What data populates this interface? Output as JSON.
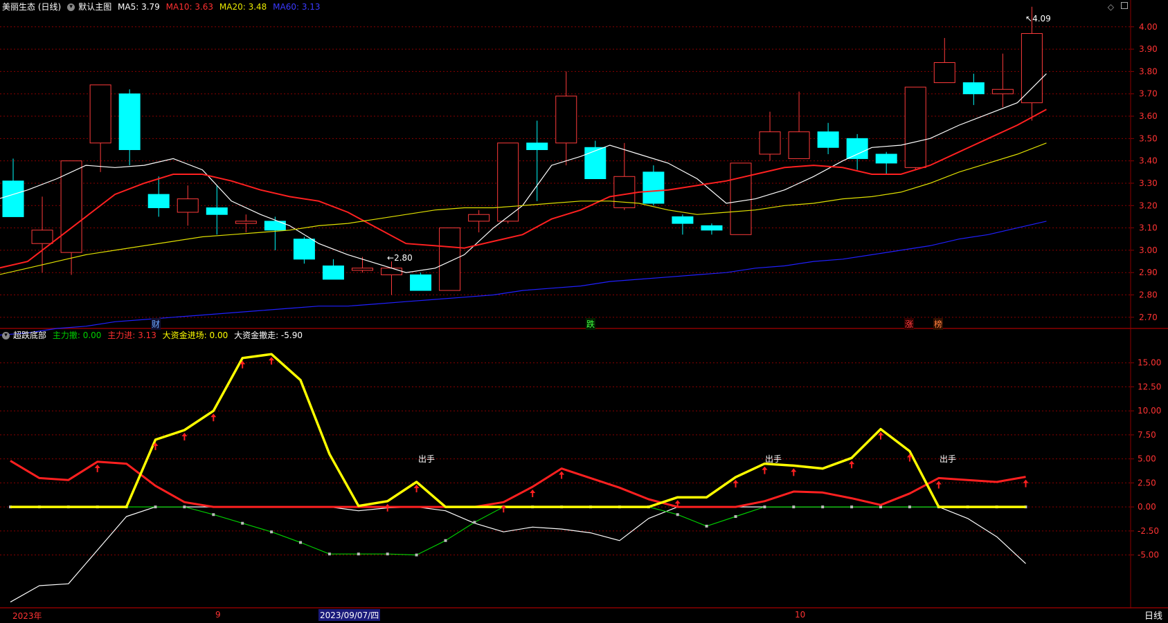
{
  "main_header": {
    "stock_title": "美丽生态 (日线)",
    "chart_name": "默认主图",
    "ma5": "MA5: 3.79",
    "ma10": "MA10: 3.63",
    "ma20": "MA20: 3.48",
    "ma60": "MA60: 3.13"
  },
  "sub_header": {
    "indicator_name": "超跌底部",
    "zhuli_che": "主力撤: 0.00",
    "zhuli_jin": "主力进: 3.13",
    "dazijin_jinchang": "大资金进场: 0.00",
    "dazijin_chezou": "大资金撤走: -5.90"
  },
  "annotations": {
    "high_label": "4.09",
    "low_label": "2.80",
    "chushou": "出手",
    "event_cai": "财",
    "event_die": "跌",
    "event_zhang": "涨",
    "event_bang": "榜"
  },
  "x_axis": {
    "year_label": "2023年",
    "month_9": "9",
    "month_10": "10",
    "selected_date": "2023/09/07/四"
  },
  "period_tab": "日线",
  "colors": {
    "up": "#ff3b3b",
    "down": "#00ffff",
    "ma5": "#ffffff",
    "ma10": "#ff2020",
    "ma20": "#e0e000",
    "ma60": "#2020ff",
    "grid": "#8b0000",
    "axis_text": "#ff3333"
  },
  "chart_data": [
    {
      "type": "candlestick",
      "title": "美丽生态 (日线)",
      "ylim": [
        2.65,
        4.12
      ],
      "yticks": [
        "2.80",
        "2.70",
        "2.80",
        "2.90",
        "3.00",
        "3.10",
        "3.20",
        "3.30",
        "3.40",
        "3.50",
        "3.60",
        "3.70",
        "3.80",
        "3.90",
        "4.00"
      ],
      "ytick_values": [
        2.6,
        2.7,
        2.8,
        2.9,
        3.0,
        3.1,
        3.2,
        3.3,
        3.4,
        3.5,
        3.6,
        3.7,
        3.8,
        3.9,
        4.0
      ],
      "candles": [
        {
          "o": 3.31,
          "h": 3.41,
          "l": 3.15,
          "c": 3.15
        },
        {
          "o": 3.03,
          "h": 3.24,
          "l": 2.9,
          "c": 3.09
        },
        {
          "o": 2.99,
          "h": 3.4,
          "l": 2.89,
          "c": 3.4
        },
        {
          "o": 3.48,
          "h": 3.74,
          "l": 3.35,
          "c": 3.74
        },
        {
          "o": 3.7,
          "h": 3.72,
          "l": 3.38,
          "c": 3.45
        },
        {
          "o": 3.25,
          "h": 3.33,
          "l": 3.15,
          "c": 3.19
        },
        {
          "o": 3.17,
          "h": 3.29,
          "l": 3.11,
          "c": 3.23
        },
        {
          "o": 3.19,
          "h": 3.29,
          "l": 3.07,
          "c": 3.16
        },
        {
          "o": 3.12,
          "h": 3.16,
          "l": 3.08,
          "c": 3.13
        },
        {
          "o": 3.13,
          "h": 3.15,
          "l": 3.0,
          "c": 3.09
        },
        {
          "o": 3.05,
          "h": 3.06,
          "l": 2.94,
          "c": 2.96
        },
        {
          "o": 2.93,
          "h": 2.96,
          "l": 2.87,
          "c": 2.87
        },
        {
          "o": 2.91,
          "h": 2.97,
          "l": 2.9,
          "c": 2.92
        },
        {
          "o": 2.89,
          "h": 2.95,
          "l": 2.8,
          "c": 2.92
        },
        {
          "o": 2.89,
          "h": 2.9,
          "l": 2.82,
          "c": 2.82
        },
        {
          "o": 2.82,
          "h": 3.1,
          "l": 2.82,
          "c": 3.1
        },
        {
          "o": 3.13,
          "h": 3.18,
          "l": 3.08,
          "c": 3.16
        },
        {
          "o": 3.13,
          "h": 3.48,
          "l": 3.12,
          "c": 3.48
        },
        {
          "o": 3.48,
          "h": 3.58,
          "l": 3.22,
          "c": 3.45
        },
        {
          "o": 3.48,
          "h": 3.8,
          "l": 3.38,
          "c": 3.69
        },
        {
          "o": 3.46,
          "h": 3.49,
          "l": 3.32,
          "c": 3.32
        },
        {
          "o": 3.19,
          "h": 3.48,
          "l": 3.18,
          "c": 3.33
        },
        {
          "o": 3.35,
          "h": 3.38,
          "l": 3.2,
          "c": 3.21
        },
        {
          "o": 3.15,
          "h": 3.16,
          "l": 3.07,
          "c": 3.12
        },
        {
          "o": 3.11,
          "h": 3.12,
          "l": 3.07,
          "c": 3.09
        },
        {
          "o": 3.07,
          "h": 3.39,
          "l": 3.07,
          "c": 3.39
        },
        {
          "o": 3.43,
          "h": 3.62,
          "l": 3.4,
          "c": 3.53
        },
        {
          "o": 3.41,
          "h": 3.71,
          "l": 3.41,
          "c": 3.53
        },
        {
          "o": 3.53,
          "h": 3.57,
          "l": 3.43,
          "c": 3.46
        },
        {
          "o": 3.5,
          "h": 3.52,
          "l": 3.36,
          "c": 3.41
        },
        {
          "o": 3.43,
          "h": 3.44,
          "l": 3.34,
          "c": 3.39
        },
        {
          "o": 3.37,
          "h": 3.73,
          "l": 3.36,
          "c": 3.73
        },
        {
          "o": 3.75,
          "h": 3.95,
          "l": 3.75,
          "c": 3.84
        },
        {
          "o": 3.75,
          "h": 3.79,
          "l": 3.65,
          "c": 3.7
        },
        {
          "o": 3.7,
          "h": 3.88,
          "l": 3.64,
          "c": 3.72
        },
        {
          "o": 3.66,
          "h": 4.09,
          "l": 3.58,
          "c": 3.97
        }
      ],
      "series": [
        {
          "name": "MA5",
          "color": "#ffffff",
          "values": [
            3.23,
            3.27,
            3.32,
            3.38,
            3.37,
            3.38,
            3.41,
            3.36,
            3.22,
            3.16,
            3.11,
            3.03,
            2.98,
            2.94,
            2.9,
            2.92,
            2.98,
            3.1,
            3.2,
            3.38,
            3.42,
            3.47,
            3.43,
            3.39,
            3.32,
            3.21,
            3.23,
            3.27,
            3.33,
            3.4,
            3.46,
            3.47,
            3.5,
            3.56,
            3.61,
            3.66,
            3.79
          ]
        },
        {
          "name": "MA10",
          "color": "#ff2020",
          "values": [
            2.92,
            2.95,
            3.05,
            3.15,
            3.25,
            3.3,
            3.34,
            3.34,
            3.31,
            3.27,
            3.24,
            3.22,
            3.17,
            3.1,
            3.03,
            3.02,
            3.01,
            3.04,
            3.07,
            3.14,
            3.18,
            3.24,
            3.26,
            3.27,
            3.29,
            3.31,
            3.34,
            3.37,
            3.38,
            3.37,
            3.34,
            3.34,
            3.38,
            3.44,
            3.5,
            3.56,
            3.63
          ]
        },
        {
          "name": "MA20",
          "color": "#e0e000",
          "values": [
            2.89,
            2.92,
            2.95,
            2.98,
            3.0,
            3.02,
            3.04,
            3.06,
            3.07,
            3.08,
            3.09,
            3.11,
            3.12,
            3.14,
            3.16,
            3.18,
            3.19,
            3.19,
            3.2,
            3.21,
            3.22,
            3.22,
            3.21,
            3.18,
            3.16,
            3.17,
            3.18,
            3.2,
            3.21,
            3.23,
            3.24,
            3.26,
            3.3,
            3.35,
            3.39,
            3.43,
            3.48
          ]
        },
        {
          "name": "MA60",
          "color": "#2020ff",
          "values": [
            2.62,
            2.63,
            2.65,
            2.66,
            2.68,
            2.69,
            2.7,
            2.71,
            2.72,
            2.73,
            2.74,
            2.75,
            2.75,
            2.76,
            2.77,
            2.78,
            2.79,
            2.8,
            2.82,
            2.83,
            2.84,
            2.86,
            2.87,
            2.88,
            2.89,
            2.9,
            2.92,
            2.93,
            2.95,
            2.96,
            2.98,
            3.0,
            3.02,
            3.05,
            3.07,
            3.1,
            3.13
          ]
        }
      ]
    },
    {
      "type": "line",
      "title": "超跌底部",
      "ylim": [
        -10.5,
        17.5
      ],
      "yticks": [
        "15.00",
        "12.50",
        "10.00",
        "7.50",
        "5.00",
        "2.50",
        "0.00",
        "-2.50",
        "-5.00"
      ],
      "ytick_values": [
        15,
        12.5,
        10,
        7.5,
        5,
        2.5,
        0,
        -2.5,
        -5
      ],
      "series": [
        {
          "name": "主力进",
          "color": "#ff2020",
          "values": [
            4.8,
            3.0,
            2.8,
            4.7,
            4.5,
            2.2,
            0.5,
            0.0,
            0.0,
            0.0,
            0.0,
            0.0,
            0.0,
            0.0,
            0.0,
            0.0,
            0.0,
            0.5,
            2.1,
            4.0,
            3.0,
            2.0,
            0.8,
            0.0,
            0.0,
            0.0,
            0.6,
            1.6,
            1.5,
            0.9,
            0.2,
            1.4,
            3.0,
            2.8,
            2.6,
            3.13
          ]
        },
        {
          "name": "大资金进场",
          "color": "#ffff00",
          "values": [
            0,
            0,
            0,
            0,
            0,
            7.0,
            8.0,
            10.0,
            15.5,
            15.9,
            13.2,
            5.5,
            0.1,
            0.6,
            2.6,
            0.0,
            0.0,
            0.0,
            0.0,
            0.0,
            0.0,
            0.0,
            0.0,
            1.0,
            1.0,
            3.1,
            4.5,
            4.3,
            4.0,
            5.1,
            8.1,
            5.8,
            0.0,
            0.0,
            0.0,
            0.0
          ]
        },
        {
          "name": "主力撤",
          "color": "#00cc00",
          "values": [
            0,
            0,
            0,
            0,
            0,
            0,
            0,
            -0.8,
            -1.7,
            -2.6,
            -3.7,
            -4.9,
            -4.9,
            -4.9,
            -5.0,
            -3.5,
            -1.6,
            0,
            0,
            0,
            0,
            0,
            0,
            -0.8,
            -2.0,
            -1.0,
            0,
            0,
            0,
            0,
            0,
            0,
            0,
            0,
            0,
            0
          ]
        },
        {
          "name": "大资金撤走",
          "color": "#ffffff",
          "values": [
            -9.9,
            -8.2,
            -8.0,
            -4.5,
            -1.0,
            0.0,
            0.0,
            0.0,
            0.0,
            0.0,
            0.0,
            0.0,
            -0.4,
            -0.1,
            0.0,
            -0.4,
            -1.7,
            -2.6,
            -2.1,
            -2.3,
            -2.7,
            -3.5,
            -1.2,
            0.0,
            0.0,
            0.0,
            0.0,
            0.0,
            0.0,
            0.0,
            0.0,
            0.0,
            0.0,
            -1.2,
            -3.1,
            -5.9
          ]
        }
      ]
    }
  ]
}
